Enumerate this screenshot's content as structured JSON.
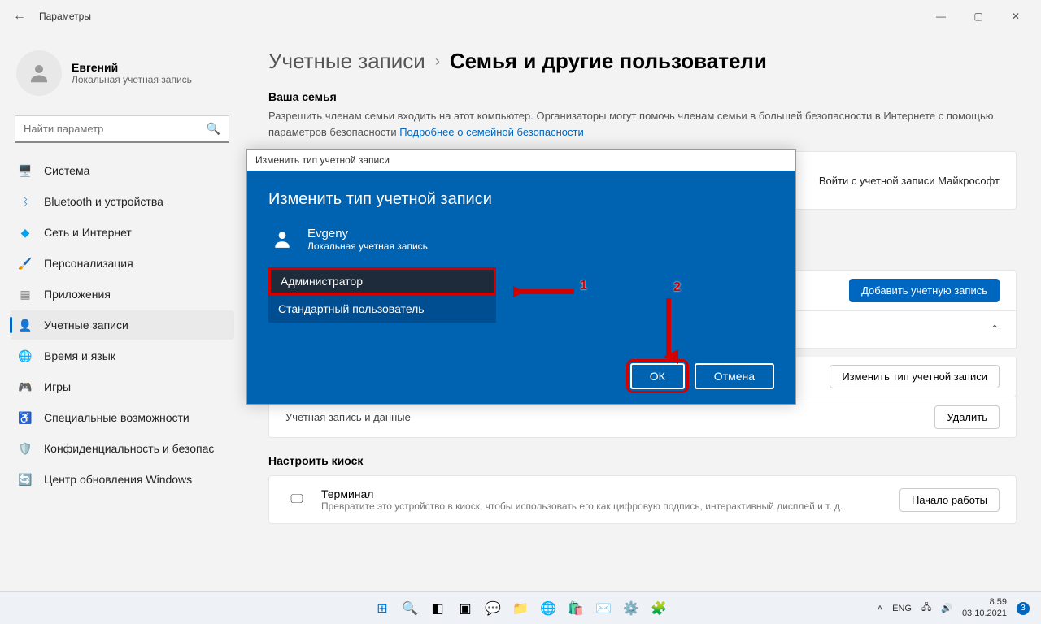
{
  "window": {
    "title": "Параметры"
  },
  "user": {
    "name": "Евгений",
    "type": "Локальная учетная запись"
  },
  "search": {
    "placeholder": "Найти параметр"
  },
  "nav": [
    {
      "label": "Система",
      "icon": "🖥️",
      "color": "#0078d4"
    },
    {
      "label": "Bluetooth и устройства",
      "icon": "ᛒ",
      "color": "#0078d4"
    },
    {
      "label": "Сеть и Интернет",
      "icon": "◆",
      "color": "#00a2ed"
    },
    {
      "label": "Персонализация",
      "icon": "🖌️",
      "color": "#c03"
    },
    {
      "label": "Приложения",
      "icon": "▦",
      "color": "#888"
    },
    {
      "label": "Учетные записи",
      "icon": "👤",
      "color": "#6b8e23",
      "active": true
    },
    {
      "label": "Время и язык",
      "icon": "🌐",
      "color": "#555"
    },
    {
      "label": "Игры",
      "icon": "🎮",
      "color": "#888"
    },
    {
      "label": "Специальные возможности",
      "icon": "♿",
      "color": "#0078d4"
    },
    {
      "label": "Конфиденциальность и безопас",
      "icon": "🛡️",
      "color": "#777"
    },
    {
      "label": "Центр обновления Windows",
      "icon": "🔄",
      "color": "#0078d4"
    }
  ],
  "breadcrumb": {
    "a": "Учетные записи",
    "b": "Семья и другие пользователи"
  },
  "family": {
    "title": "Ваша семья",
    "desc": "Разрешить членам семьи входить на этот компьютер. Организаторы могут помочь членам семьи в большей безопасности в Интернете с помощью параметров безопасности ",
    "link": "Подробнее о семейной безопасности",
    "signin": "Войти с учетной записи Майкрософт"
  },
  "otherUsers": {
    "addBtn": "Добавить учетную запись",
    "changeType": "Изменить тип учетной записи",
    "accountData": "Учетная запись и данные",
    "remove": "Удалить"
  },
  "kiosk": {
    "title": "Настроить киоск",
    "cardTitle": "Терминал",
    "cardDesc": "Превратите это устройство в киоск, чтобы использовать его как цифровую подпись, интерактивный дисплей и т. д.",
    "btn": "Начало работы"
  },
  "modal": {
    "winTitle": "Изменить тип учетной записи",
    "heading": "Изменить тип учетной записи",
    "userName": "Evgeny",
    "userType": "Локальная учетная запись",
    "opt1": "Администратор",
    "opt2": "Стандартный пользователь",
    "ok": "ОК",
    "cancel": "Отмена"
  },
  "annotations": {
    "n1": "1",
    "n2": "2"
  },
  "taskbar": {
    "lang": "ENG",
    "time": "8:59",
    "date": "03.10.2021",
    "notif": "3"
  }
}
